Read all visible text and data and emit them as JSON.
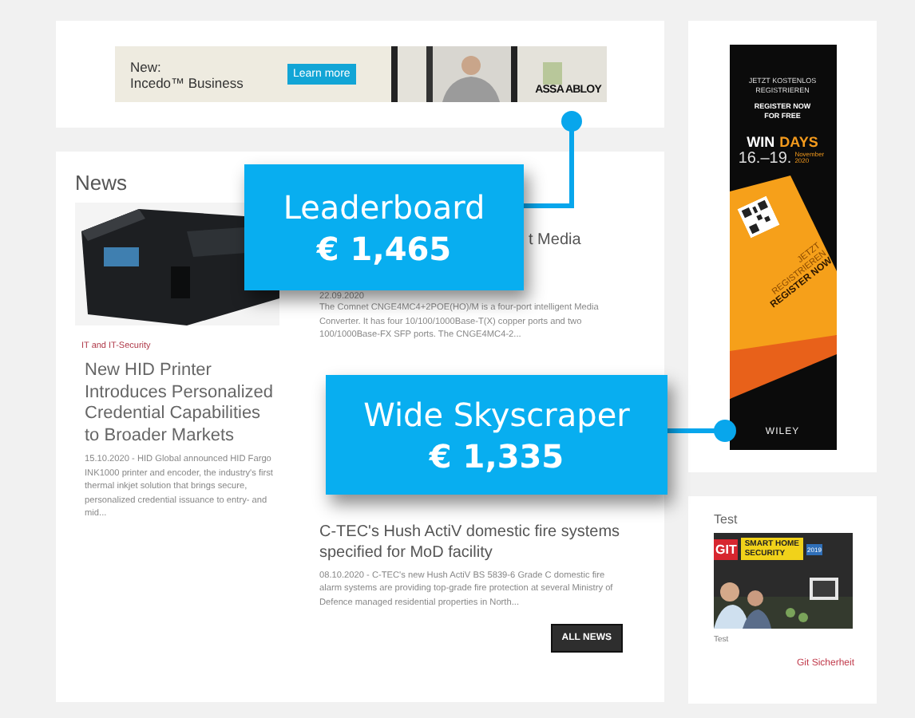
{
  "leaderboard_ad": {
    "kicker": "New:",
    "product": "Incedo™ Business",
    "button": "Learn more",
    "brand": "ASSA ABLOY"
  },
  "news": {
    "heading": "News",
    "featured": {
      "tag": "IT and IT-Security",
      "title": "New HID Printer Introduces Personalized Credential Capabilities to Broader Markets",
      "body": "15.10.2020 - HID Global announced HID Fargo INK1000 printer and encoder, the industry's first thermal inkjet solution that brings secure, personalized credential issuance to entry- and mid..."
    },
    "articles": [
      {
        "title": "t Media",
        "date": "22.09.2020",
        "body": "The Comnet CNGE4MC4+2POE(HO)/M is a four-port intelligent Media Converter. It has four 10/100/1000Base-T(X) copper ports and two 100/1000Base-FX SFP ports. The CNGE4MC4-2..."
      },
      {
        "title": "C-TEC's Hush ActiV domestic fire systems specified for MoD facility",
        "body": "08.10.2020 - C-TEC's new Hush ActiV BS 5839-6 Grade C domestic fire alarm systems are providing top-grade fire protection at several Ministry of Defence managed residential properties in North..."
      }
    ],
    "button": "ALL NEWS"
  },
  "skyscraper_ad": {
    "lines": [
      "JETZT KOSTENLOS",
      "REGISTRIEREN"
    ],
    "register": [
      "REGISTER NOW",
      "FOR FREE"
    ],
    "win": "WIN",
    "days": "DAYS",
    "dates": "16.–19.",
    "month": "November 2020",
    "cta_top": "JETZT",
    "cta_mid": "REGISTRIEREN",
    "cta": "REGISTER NOW",
    "brand": "WILEY"
  },
  "test_widget": {
    "heading": "Test",
    "cover": {
      "masthead": "GIT",
      "title_1": "SMART HOME",
      "title_2": "SECURITY",
      "year": "2019"
    },
    "caption": "Test",
    "link": "Git Sicherheit"
  },
  "callouts": [
    {
      "label": "Leaderboard",
      "price": "€ 1,465"
    },
    {
      "label": "Wide Skyscraper",
      "price": "€ 1,335"
    }
  ]
}
